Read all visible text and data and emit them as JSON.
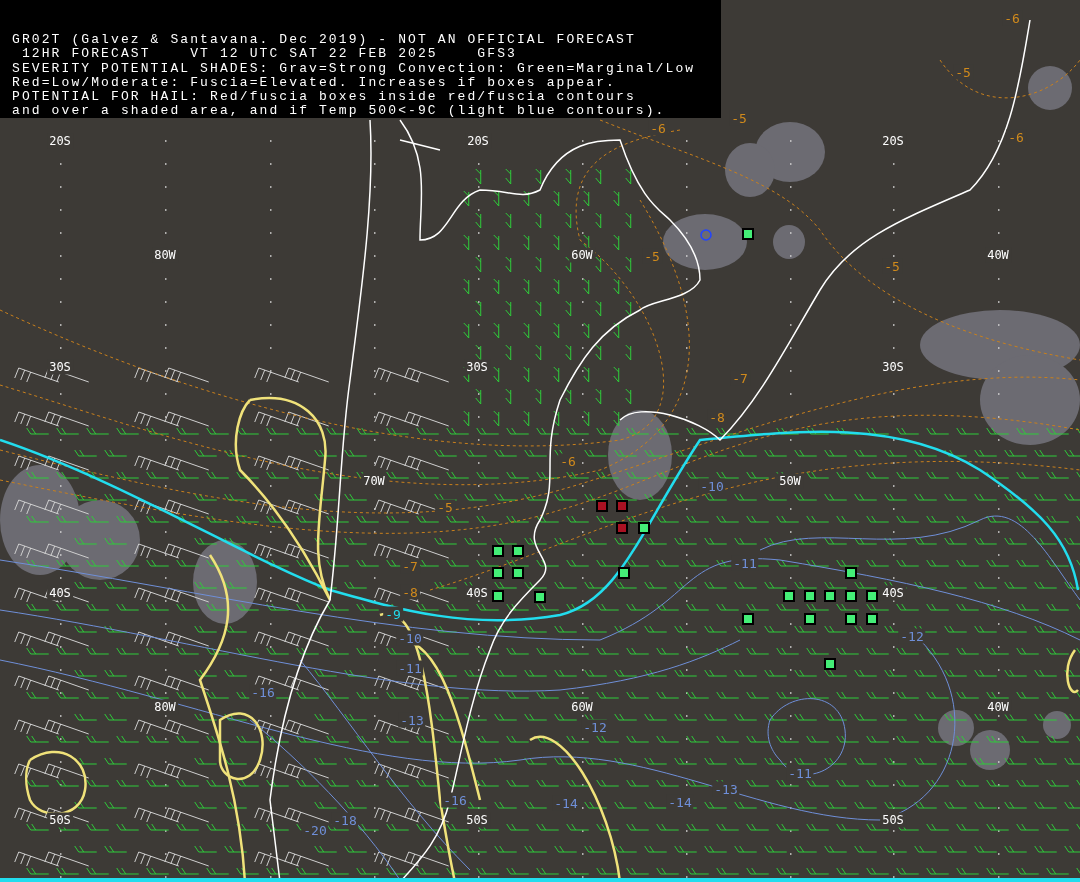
{
  "header": {
    "lines": [
      "GR02T (Galvez & Santavana. Dec 2019) - NOT AN OFFICIAL FORECAST",
      " 12HR FORECAST    VT 12 UTC SAT 22 FEB 2025    GFS3",
      "SEVERITY POTENTIAL SHADES: Grav=Strong Convection: Green=Marginal/Low",
      "Red=Low/Moderate: Fuscia=Elevated. Increases if boxes appear.",
      "POTENTIAL FOR HAIL: Red/fuscia boxes inside red/fuscia contours",
      "and over a shaded area, and if Temp 500<-9C (light blue contours)."
    ]
  },
  "grid_labels": [
    "20S",
    "20S",
    "20S",
    "80W",
    "60W",
    "40W",
    "30S",
    "30S",
    "30S",
    "70W",
    "50W",
    "40S",
    "40S",
    "40S",
    "80W",
    "60W",
    "40W",
    "50S",
    "50S",
    "50S"
  ],
  "contour_labels": [
    {
      "text": "-6",
      "color": "#d08a1c"
    },
    {
      "text": "-5",
      "color": "#d08a1c"
    },
    {
      "text": "-5",
      "color": "#d08a1c"
    },
    {
      "text": "-6",
      "color": "#d08a1c"
    },
    {
      "text": "-6",
      "color": "#d08a1c"
    },
    {
      "text": "-5",
      "color": "#d08a1c"
    },
    {
      "text": "-5",
      "color": "#d08a1c"
    },
    {
      "text": "-7",
      "color": "#d08a1c"
    },
    {
      "text": "-8",
      "color": "#d08a1c"
    },
    {
      "text": "-6",
      "color": "#d08a1c"
    },
    {
      "text": "-5",
      "color": "#d08a1c"
    },
    {
      "text": "-7",
      "color": "#d08a1c"
    },
    {
      "text": "-8",
      "color": "#d08a1c"
    },
    {
      "text": "-9",
      "color": "#22ddee"
    },
    {
      "text": "-10",
      "color": "#6f8fd8"
    },
    {
      "text": "-10",
      "color": "#6f8fd8"
    },
    {
      "text": "-11",
      "color": "#6f8fd8"
    },
    {
      "text": "-13",
      "color": "#6f8fd8"
    },
    {
      "text": "-16",
      "color": "#6f8fd8"
    },
    {
      "text": "-16",
      "color": "#6f8fd8"
    },
    {
      "text": "-18",
      "color": "#6f8fd8"
    },
    {
      "text": "-20",
      "color": "#6f8fd8"
    },
    {
      "text": "-11",
      "color": "#6f8fd8"
    },
    {
      "text": "-12",
      "color": "#6f8fd8"
    },
    {
      "text": "-12",
      "color": "#6f8fd8"
    },
    {
      "text": "-11",
      "color": "#6f8fd8"
    },
    {
      "text": "-13",
      "color": "#6f8fd8"
    },
    {
      "text": "-14",
      "color": "#6f8fd8"
    },
    {
      "text": "-14",
      "color": "#6f8fd8"
    }
  ],
  "hail_boxes": [
    {
      "color": "#44ee77"
    },
    {
      "color": "#aa1122"
    },
    {
      "color": "#aa1122"
    },
    {
      "color": "#aa1122"
    },
    {
      "color": "#44ee77"
    },
    {
      "color": "#44ee77"
    },
    {
      "color": "#44ee77"
    },
    {
      "color": "#44ee77"
    },
    {
      "color": "#44ee77"
    },
    {
      "color": "#44ee77"
    },
    {
      "color": "#44ee77"
    },
    {
      "color": "#44ee77"
    },
    {
      "color": "#44ee77"
    },
    {
      "color": "#44ee77"
    },
    {
      "color": "#44ee77"
    },
    {
      "color": "#44ee77"
    },
    {
      "color": "#44ee77"
    },
    {
      "color": "#44ee77"
    },
    {
      "color": "#44ee77"
    },
    {
      "color": "#44ee77"
    },
    {
      "color": "#44ee77"
    },
    {
      "color": "#44ee77"
    },
    {
      "color": "#44ee77"
    }
  ]
}
